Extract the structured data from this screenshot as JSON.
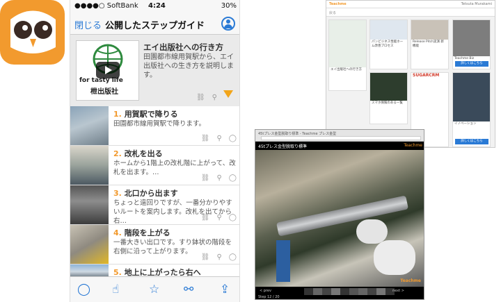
{
  "phone": {
    "status": {
      "carrier": "●●●●○ SoftBank",
      "time": "4:24",
      "battery": "30%"
    },
    "nav": {
      "close": "閉じる",
      "title": "公開したステップガイド"
    },
    "hero": {
      "title": "エイ出版社への行き方",
      "desc": "田園都市線用賀駅から、エイ出版社への生き方を説明します。",
      "thumb_text": "for tasty life",
      "thumb_sub": "枻出版社"
    },
    "steps": [
      {
        "num": "1.",
        "title": "用賀駅で降りる",
        "desc": "田園都市線用賀駅で降ります。"
      },
      {
        "num": "2.",
        "title": "改札を出る",
        "desc": "ホームから1階上の改札階に上がって、改札を出ます。…"
      },
      {
        "num": "3.",
        "title": "北口から出ます",
        "desc": "ちょっと遠回りですが、一番分かりやすいルートを案内します。改札を出てから右…"
      },
      {
        "num": "4.",
        "title": "階段を上がる",
        "desc": "一番大きい出口です。すり鉢状の階段を右側に沿って上がります。"
      },
      {
        "num": "5.",
        "title": "地上に上がったら右へ",
        "desc": ""
      }
    ]
  },
  "web": {
    "brand": "Teachme",
    "user": "Tetsuta Murakami",
    "back": "戻る",
    "cards": [
      {
        "title": "エイ出版社への行き方",
        "button": ""
      },
      {
        "title": "パンビジネス性能ホーム改善プロセス",
        "button": ""
      },
      {
        "title": "Release Pitch実演 新機能",
        "button": ""
      },
      {
        "title": "Teachme Biz",
        "button": "詳しくはこちら"
      },
      {
        "title": "スマホ保険のある一覧",
        "button": ""
      },
      {
        "title": "SUGARCRM",
        "button": ""
      },
      {
        "title": "イノベーション",
        "button": "詳しくはこちら"
      }
    ]
  },
  "video": {
    "tab": "45tプレス金型脱取り標準 - Teachme プレス金型",
    "title": "45tプレス金型脱取り標準",
    "brand": "Teachme",
    "prev": "< prev",
    "next": "next >",
    "step": "Step 12 / 20"
  }
}
